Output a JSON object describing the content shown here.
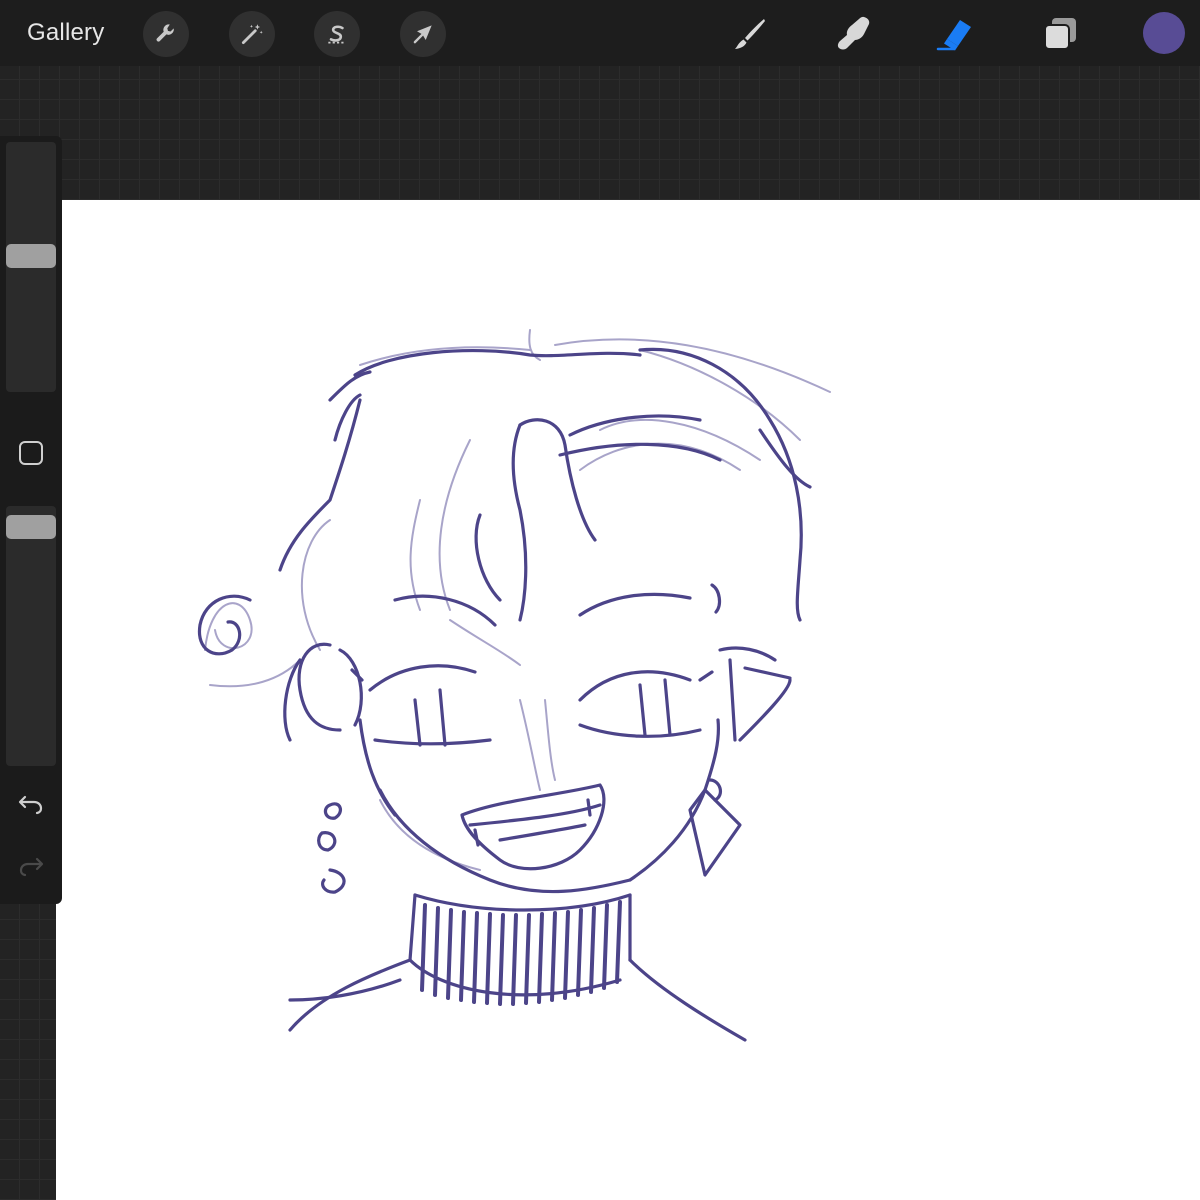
{
  "toolbar": {
    "gallery_label": "Gallery",
    "left_tools": [
      {
        "name": "actions",
        "icon": "wrench-icon"
      },
      {
        "name": "adjustments",
        "icon": "magic-wand-icon"
      },
      {
        "name": "selection",
        "icon": "selection-s-icon"
      },
      {
        "name": "transform",
        "icon": "arrow-cursor-icon"
      }
    ],
    "right_tools": [
      {
        "name": "brush",
        "icon": "brush-icon",
        "active": false
      },
      {
        "name": "smudge",
        "icon": "smudge-finger-icon",
        "active": false
      },
      {
        "name": "eraser",
        "icon": "eraser-icon",
        "active": true
      },
      {
        "name": "layers",
        "icon": "layers-icon",
        "active": false
      }
    ],
    "current_color": "#584c95"
  },
  "sidebar": {
    "brush_size_level": 0.55,
    "opacity_level": 0.96,
    "modify_button_icon": "square-modify-icon",
    "undo_icon": "undo-icon",
    "redo_icon": "redo-icon",
    "redo_enabled": false
  },
  "colors": {
    "toolbar_bg": "#1d1d1d",
    "workspace_bg": "#232323",
    "canvas_bg": "#ffffff",
    "active_tool": "#1a7cf5",
    "icon_gray": "#bdbdbd",
    "sketch_stroke": "#4c4489"
  },
  "canvas": {
    "content": "sketch-of-smiling-character-with-curly-hair-and-turtleneck"
  }
}
